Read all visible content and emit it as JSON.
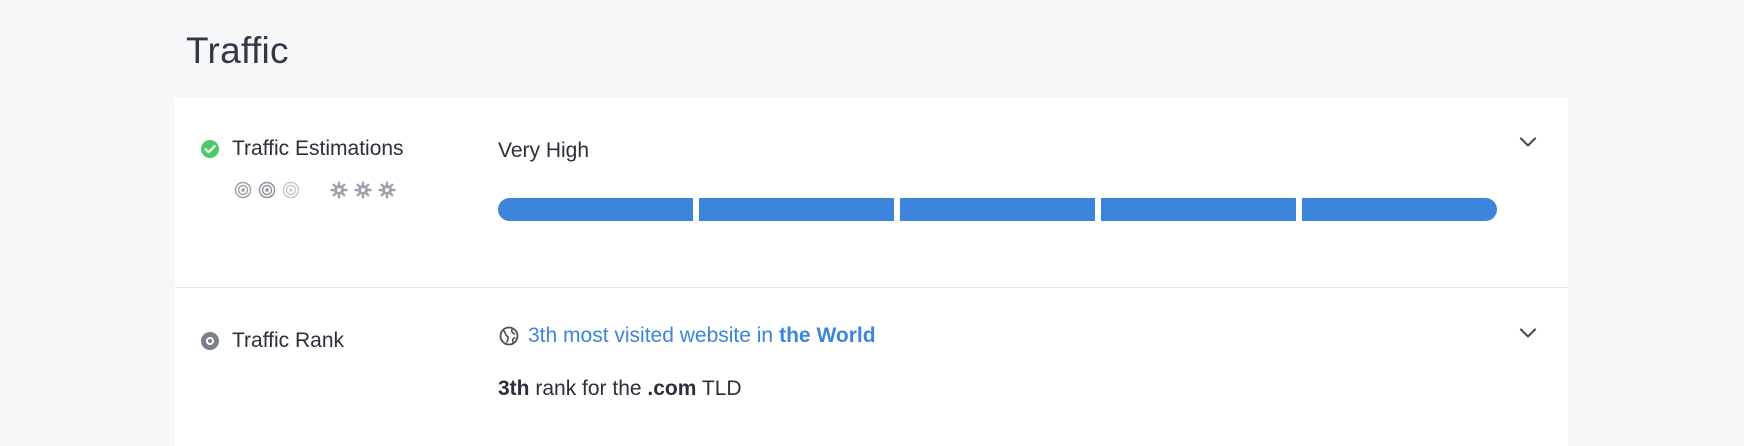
{
  "section": {
    "title": "Traffic"
  },
  "traffic_estimations": {
    "label": "Traffic Estimations",
    "status_icon": "check-circle-icon",
    "value": "Very High",
    "meter_segments_filled": 5,
    "meter_segments_total": 5,
    "badge_icons": [
      "target-icon",
      "target-icon",
      "target-icon-faded",
      "gear-icon",
      "gear-icon",
      "gear-icon"
    ],
    "accent_color": "#3d84dc",
    "status_color": "#4cc96a"
  },
  "traffic_rank": {
    "label": "Traffic Rank",
    "status_icon": "eye-icon",
    "rank_prefix": "3th most visited website in",
    "rank_scope": "the World",
    "tld_rank": "3th",
    "tld_middle": "rank for the",
    "tld_name": ".com",
    "tld_suffix": "TLD"
  }
}
